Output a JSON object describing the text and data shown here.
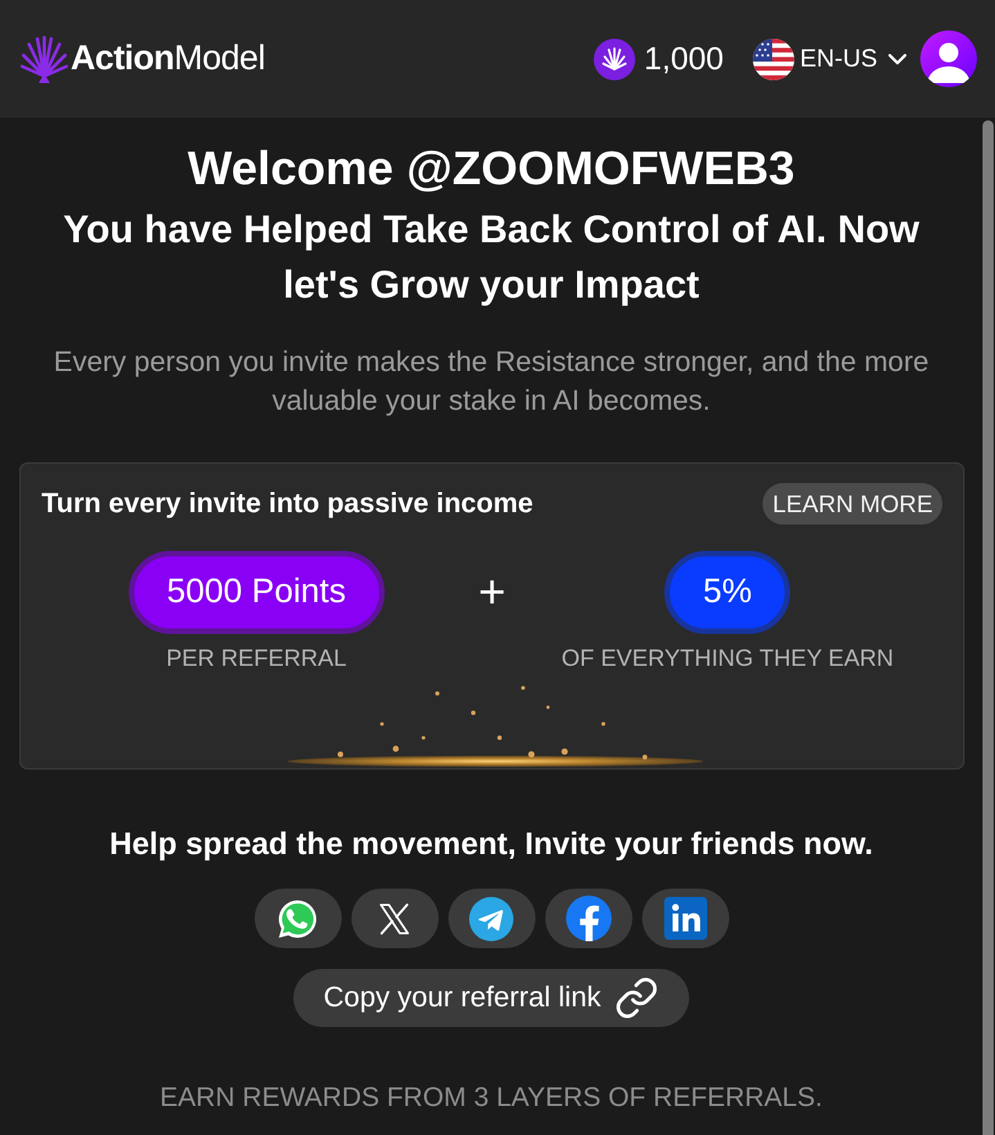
{
  "header": {
    "logo": "**Action**Model",
    "points": "1,000",
    "language": "EN-US"
  },
  "hero": {
    "title": "Welcome @ZOOMOFWEB3",
    "subtitle": "You have Helped Take Back Control of AI. Now let's Grow your Impact",
    "description": "Every person you invite makes the Resistance stronger, and the more valuable your stake in AI becomes."
  },
  "reward_card": {
    "title": "Turn every invite into passive income",
    "learn_more": "LEARN MORE",
    "rewards": [
      {
        "value": "5000 Points",
        "caption": "PER REFERRAL",
        "color": "#8a00f5"
      },
      {
        "value": "5%",
        "caption": "OF EVERYTHING THEY EARN",
        "color": "#0a3cff"
      }
    ],
    "separator": "+"
  },
  "share": {
    "heading": "Help spread the movement, Invite your friends now.",
    "networks": [
      {
        "kind": "whatsapp"
      },
      {
        "kind": "x"
      },
      {
        "kind": "telegram"
      },
      {
        "kind": "facebook"
      },
      {
        "kind": "linkedin"
      }
    ],
    "copy_link": "Copy your referral link"
  },
  "note": "EARN REWARDS FROM 3 LAYERS OF REFERRALS."
}
